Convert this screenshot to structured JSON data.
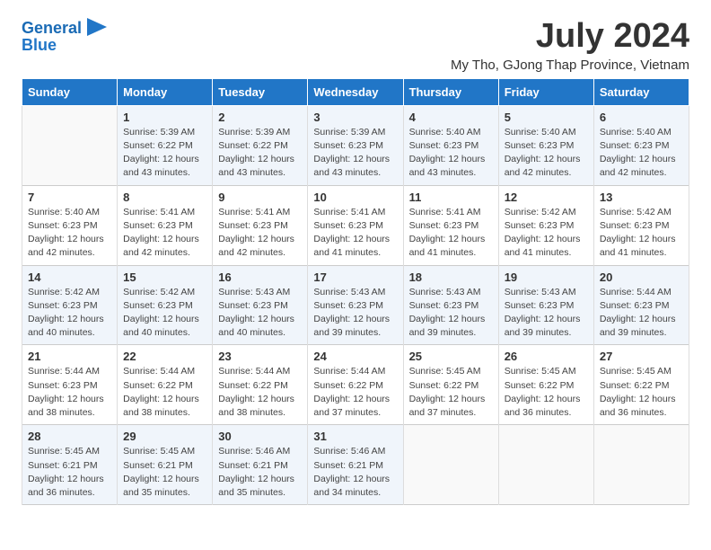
{
  "header": {
    "logo_line1": "General",
    "logo_line2": "Blue",
    "month_title": "July 2024",
    "subtitle": "My Tho, GJong Thap Province, Vietnam"
  },
  "days_of_week": [
    "Sunday",
    "Monday",
    "Tuesday",
    "Wednesday",
    "Thursday",
    "Friday",
    "Saturday"
  ],
  "weeks": [
    [
      {
        "day": "",
        "info": ""
      },
      {
        "day": "1",
        "info": "Sunrise: 5:39 AM\nSunset: 6:22 PM\nDaylight: 12 hours\nand 43 minutes."
      },
      {
        "day": "2",
        "info": "Sunrise: 5:39 AM\nSunset: 6:22 PM\nDaylight: 12 hours\nand 43 minutes."
      },
      {
        "day": "3",
        "info": "Sunrise: 5:39 AM\nSunset: 6:23 PM\nDaylight: 12 hours\nand 43 minutes."
      },
      {
        "day": "4",
        "info": "Sunrise: 5:40 AM\nSunset: 6:23 PM\nDaylight: 12 hours\nand 43 minutes."
      },
      {
        "day": "5",
        "info": "Sunrise: 5:40 AM\nSunset: 6:23 PM\nDaylight: 12 hours\nand 42 minutes."
      },
      {
        "day": "6",
        "info": "Sunrise: 5:40 AM\nSunset: 6:23 PM\nDaylight: 12 hours\nand 42 minutes."
      }
    ],
    [
      {
        "day": "7",
        "info": "Sunrise: 5:40 AM\nSunset: 6:23 PM\nDaylight: 12 hours\nand 42 minutes."
      },
      {
        "day": "8",
        "info": "Sunrise: 5:41 AM\nSunset: 6:23 PM\nDaylight: 12 hours\nand 42 minutes."
      },
      {
        "day": "9",
        "info": "Sunrise: 5:41 AM\nSunset: 6:23 PM\nDaylight: 12 hours\nand 42 minutes."
      },
      {
        "day": "10",
        "info": "Sunrise: 5:41 AM\nSunset: 6:23 PM\nDaylight: 12 hours\nand 41 minutes."
      },
      {
        "day": "11",
        "info": "Sunrise: 5:41 AM\nSunset: 6:23 PM\nDaylight: 12 hours\nand 41 minutes."
      },
      {
        "day": "12",
        "info": "Sunrise: 5:42 AM\nSunset: 6:23 PM\nDaylight: 12 hours\nand 41 minutes."
      },
      {
        "day": "13",
        "info": "Sunrise: 5:42 AM\nSunset: 6:23 PM\nDaylight: 12 hours\nand 41 minutes."
      }
    ],
    [
      {
        "day": "14",
        "info": "Sunrise: 5:42 AM\nSunset: 6:23 PM\nDaylight: 12 hours\nand 40 minutes."
      },
      {
        "day": "15",
        "info": "Sunrise: 5:42 AM\nSunset: 6:23 PM\nDaylight: 12 hours\nand 40 minutes."
      },
      {
        "day": "16",
        "info": "Sunrise: 5:43 AM\nSunset: 6:23 PM\nDaylight: 12 hours\nand 40 minutes."
      },
      {
        "day": "17",
        "info": "Sunrise: 5:43 AM\nSunset: 6:23 PM\nDaylight: 12 hours\nand 39 minutes."
      },
      {
        "day": "18",
        "info": "Sunrise: 5:43 AM\nSunset: 6:23 PM\nDaylight: 12 hours\nand 39 minutes."
      },
      {
        "day": "19",
        "info": "Sunrise: 5:43 AM\nSunset: 6:23 PM\nDaylight: 12 hours\nand 39 minutes."
      },
      {
        "day": "20",
        "info": "Sunrise: 5:44 AM\nSunset: 6:23 PM\nDaylight: 12 hours\nand 39 minutes."
      }
    ],
    [
      {
        "day": "21",
        "info": "Sunrise: 5:44 AM\nSunset: 6:23 PM\nDaylight: 12 hours\nand 38 minutes."
      },
      {
        "day": "22",
        "info": "Sunrise: 5:44 AM\nSunset: 6:22 PM\nDaylight: 12 hours\nand 38 minutes."
      },
      {
        "day": "23",
        "info": "Sunrise: 5:44 AM\nSunset: 6:22 PM\nDaylight: 12 hours\nand 38 minutes."
      },
      {
        "day": "24",
        "info": "Sunrise: 5:44 AM\nSunset: 6:22 PM\nDaylight: 12 hours\nand 37 minutes."
      },
      {
        "day": "25",
        "info": "Sunrise: 5:45 AM\nSunset: 6:22 PM\nDaylight: 12 hours\nand 37 minutes."
      },
      {
        "day": "26",
        "info": "Sunrise: 5:45 AM\nSunset: 6:22 PM\nDaylight: 12 hours\nand 36 minutes."
      },
      {
        "day": "27",
        "info": "Sunrise: 5:45 AM\nSunset: 6:22 PM\nDaylight: 12 hours\nand 36 minutes."
      }
    ],
    [
      {
        "day": "28",
        "info": "Sunrise: 5:45 AM\nSunset: 6:21 PM\nDaylight: 12 hours\nand 36 minutes."
      },
      {
        "day": "29",
        "info": "Sunrise: 5:45 AM\nSunset: 6:21 PM\nDaylight: 12 hours\nand 35 minutes."
      },
      {
        "day": "30",
        "info": "Sunrise: 5:46 AM\nSunset: 6:21 PM\nDaylight: 12 hours\nand 35 minutes."
      },
      {
        "day": "31",
        "info": "Sunrise: 5:46 AM\nSunset: 6:21 PM\nDaylight: 12 hours\nand 34 minutes."
      },
      {
        "day": "",
        "info": ""
      },
      {
        "day": "",
        "info": ""
      },
      {
        "day": "",
        "info": ""
      }
    ]
  ]
}
